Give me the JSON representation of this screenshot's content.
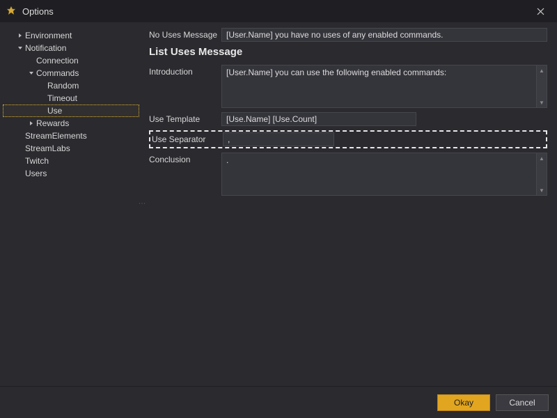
{
  "window": {
    "title": "Options"
  },
  "sidebar": {
    "items": [
      {
        "label": "Environment",
        "depth": 0,
        "caret": "right"
      },
      {
        "label": "Notification",
        "depth": 0,
        "caret": "down"
      },
      {
        "label": "Connection",
        "depth": 1,
        "caret": ""
      },
      {
        "label": "Commands",
        "depth": 1,
        "caret": "down"
      },
      {
        "label": "Random",
        "depth": 2,
        "caret": ""
      },
      {
        "label": "Timeout",
        "depth": 2,
        "caret": ""
      },
      {
        "label": "Use",
        "depth": 2,
        "caret": "",
        "selected": true
      },
      {
        "label": "Rewards",
        "depth": 1,
        "caret": "right"
      },
      {
        "label": "StreamElements",
        "depth": 0,
        "caret": ""
      },
      {
        "label": "StreamLabs",
        "depth": 0,
        "caret": ""
      },
      {
        "label": "Twitch",
        "depth": 0,
        "caret": ""
      },
      {
        "label": "Users",
        "depth": 0,
        "caret": ""
      }
    ]
  },
  "main": {
    "noUsesLabel": "No Uses Message",
    "noUsesValue": "[User.Name] you have no uses of any enabled commands.",
    "sectionTitle": "List Uses Message",
    "introLabel": "Introduction",
    "introValue": "[User.Name] you can use the following enabled commands:",
    "useTemplateLabel": "Use Template",
    "useTemplateValue": "[Use.Name] [Use.Count]",
    "useSeparatorLabel": "Use Separator",
    "useSeparatorValue": ",",
    "conclusionLabel": "Conclusion",
    "conclusionValue": "."
  },
  "footer": {
    "okay": "Okay",
    "cancel": "Cancel"
  }
}
